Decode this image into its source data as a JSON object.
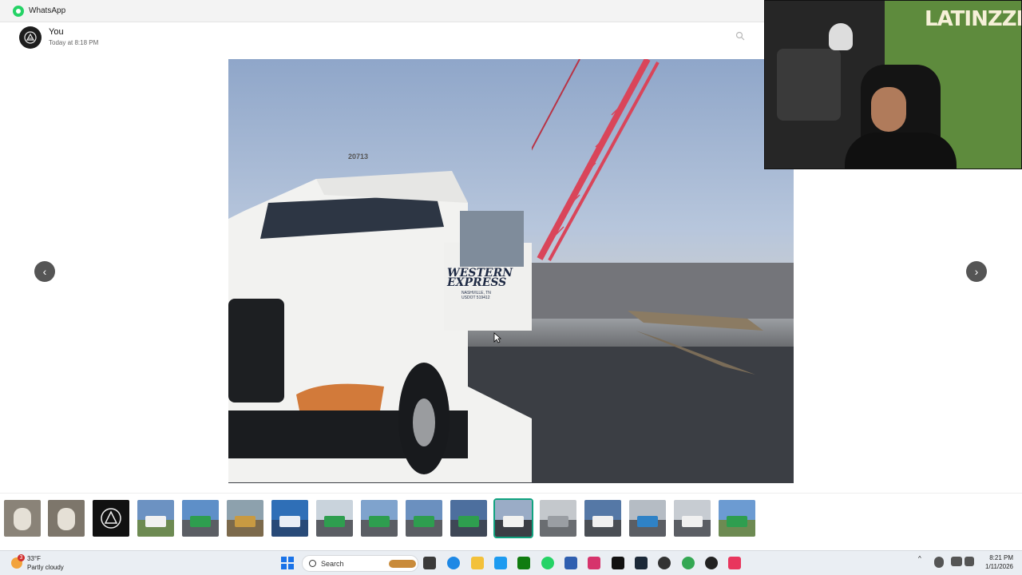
{
  "window": {
    "title": "WhatsApp"
  },
  "header": {
    "sender": "You",
    "timestamp": "Today at 8:18 PM"
  },
  "viewer": {
    "prev_label": "‹",
    "next_label": "›",
    "thumbnail_count": 17,
    "active_thumbnail_index": 11
  },
  "photo": {
    "truck_number": "20713",
    "door_text_line1": "WESTERN",
    "door_text_line2": "EXPRESS",
    "door_text_line3": "NASHVILLE, TN",
    "door_text_line4": "USDOT 519412"
  },
  "webcam": {
    "graffiti_text": "LATINZZR!"
  },
  "taskbar": {
    "weather_temp": "33°F",
    "weather_condition": "Partly cloudy",
    "weather_badge": "3",
    "search_label": "Search",
    "time": "8:21 PM",
    "date": "1/11/2026"
  },
  "colors": {
    "accent": "#10a37f",
    "whatsapp_green": "#25d366",
    "crane_red": "#d9455a"
  }
}
